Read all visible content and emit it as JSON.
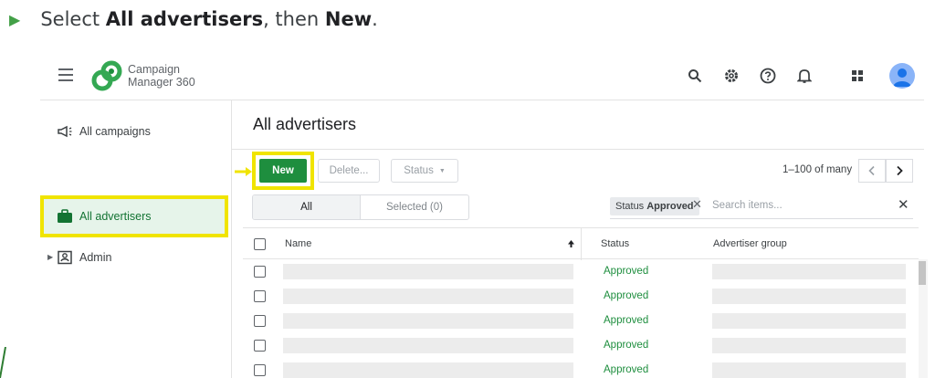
{
  "instruction": {
    "prefix": "Select ",
    "bold1": "All advertisers",
    "middle": ", then ",
    "bold2": "New",
    "suffix": "."
  },
  "brand": {
    "line1": "Campaign",
    "line2": "Manager 360"
  },
  "topbar_icons": [
    "search-icon",
    "settings-icon",
    "help-icon",
    "notifications-icon",
    "apps-icon",
    "avatar"
  ],
  "sidebar": {
    "items": [
      {
        "label": "All campaigns",
        "icon": "megaphone-icon"
      },
      {
        "label": "All advertisers",
        "icon": "briefcase-icon",
        "active": true
      },
      {
        "label": "Admin",
        "icon": "admin-icon"
      }
    ]
  },
  "main": {
    "title": "All advertisers",
    "toolbar": {
      "new_label": "New",
      "delete_label": "Delete...",
      "status_label": "Status"
    },
    "pager": {
      "range": "1–100 of many"
    },
    "segments": {
      "all_label": "All",
      "selected_label": "Selected (0)"
    },
    "filter": {
      "chip_key": "Status",
      "chip_value": "Approved",
      "search_placeholder": "Search items..."
    },
    "table": {
      "headers": {
        "name": "Name",
        "status": "Status",
        "group": "Advertiser group"
      },
      "rows": [
        {
          "status": "Approved"
        },
        {
          "status": "Approved"
        },
        {
          "status": "Approved"
        },
        {
          "status": "Approved"
        },
        {
          "status": "Approved"
        }
      ]
    }
  },
  "colors": {
    "accent_green": "#1e8e3e",
    "highlight_yellow": "#f0e400",
    "active_bg": "#e6f4ea"
  }
}
